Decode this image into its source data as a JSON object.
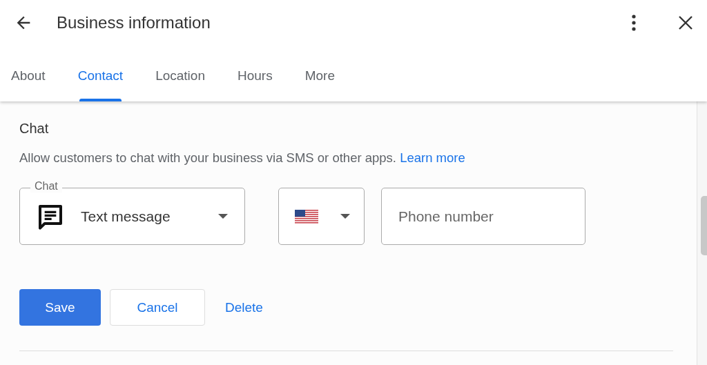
{
  "header": {
    "title": "Business information"
  },
  "tabs": [
    {
      "label": "About",
      "selected": false
    },
    {
      "label": "Contact",
      "selected": true
    },
    {
      "label": "Location",
      "selected": false
    },
    {
      "label": "Hours",
      "selected": false
    },
    {
      "label": "More",
      "selected": false
    }
  ],
  "section": {
    "title": "Chat",
    "description": "Allow customers to chat with your business via SMS or other apps.",
    "link": "Learn more"
  },
  "chat_select": {
    "label": "Chat",
    "value": "Text message"
  },
  "phone_field": {
    "placeholder": "Phone number"
  },
  "buttons": [
    {
      "label": "Save",
      "kind": "primary"
    },
    {
      "label": "Cancel",
      "kind": "outlined"
    },
    {
      "label": "Delete",
      "kind": "text"
    }
  ]
}
